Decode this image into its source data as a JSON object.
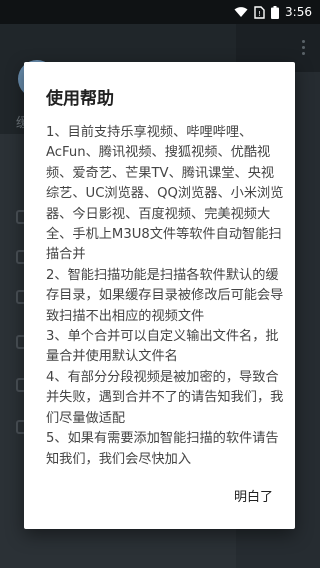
{
  "status_bar": {
    "time": "3:56",
    "icons": [
      "wifi-icon",
      "no-sim-icon",
      "battery-icon"
    ]
  },
  "dialog": {
    "title": "使用帮助",
    "paragraphs": [
      "1、目前支持乐享视频、哔哩哔哩、AcFun、腾讯视频、搜狐视频、优酷视频、爱奇艺、芒果TV、腾讯课堂、央视综艺、UC浏览器、QQ浏览器、小米浏览器、今日影视、百度视频、完美视频大全、手机上M3U8文件等软件自动智能扫描合并",
      "2、智能扫描功能是扫描各软件默认的缓存目录，如果缓存目录被修改后可能会导致扫描不出相应的视频文件",
      "3、单个合并可以自定义输出文件名，批量合并使用默认文件名",
      "4、有部分分段视频是被加密的，导致合并失败，遇到合并不了的请告知我们，我们尽量做适配",
      "5、如果有需要添加智能扫描的软件请告知我们，我们会尽快加入"
    ],
    "confirm_label": "明白了"
  },
  "background": {
    "drawer_label_partial": "缓"
  }
}
